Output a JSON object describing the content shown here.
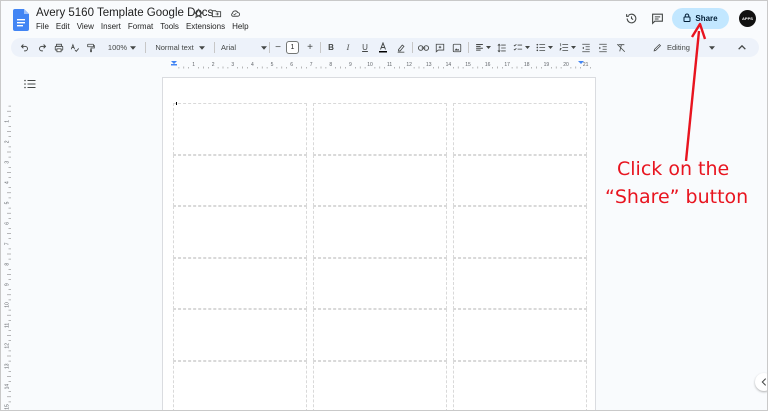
{
  "app": {
    "document_title": "Avery 5160 Template Google Docs",
    "menu": [
      "File",
      "Edit",
      "View",
      "Insert",
      "Format",
      "Tools",
      "Extensions",
      "Help"
    ]
  },
  "header": {
    "share_label": "Share",
    "avatar_text": "APPS"
  },
  "toolbar": {
    "zoom": "100%",
    "style": "Normal text",
    "font": "Arial",
    "font_size": "1",
    "mode": "Editing"
  },
  "ruler": {
    "h_numbers": [
      "1",
      "2",
      "3",
      "4",
      "5",
      "6",
      "7",
      "8",
      "9",
      "10",
      "11",
      "12",
      "13",
      "14",
      "15",
      "16",
      "17",
      "18",
      "19",
      "20",
      "21"
    ],
    "v_numbers": [
      "1",
      "2",
      "3",
      "4",
      "5",
      "6",
      "7",
      "8",
      "9",
      "10",
      "11",
      "12",
      "13",
      "14",
      "15"
    ]
  },
  "annotation": {
    "line1": "Click on the",
    "line2": "“Share” button"
  },
  "colors": {
    "accent": "#c2e7ff",
    "annotation": "#e8141f",
    "docs_blue": "#4285f4"
  }
}
